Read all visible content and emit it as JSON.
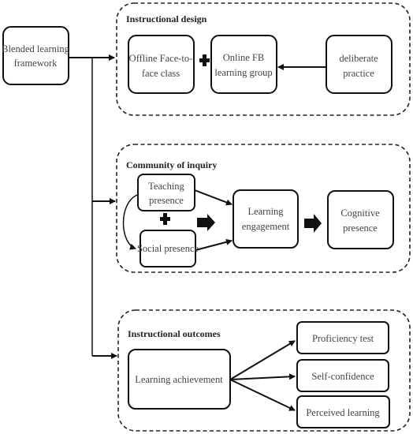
{
  "diagram": {
    "root": {
      "label_line1": "Blended learning",
      "label_line2": "framework"
    },
    "groups": {
      "instructional_design": {
        "title": "Instructional design",
        "nodes": {
          "offline": {
            "line1": "Offline Face-to-",
            "line2": "face class"
          },
          "online": {
            "line1": "Online FB",
            "line2": "learning group"
          },
          "practice": {
            "line1": "deliberate",
            "line2": "practice"
          }
        }
      },
      "community_of_inquiry": {
        "title": "Community of inquiry",
        "nodes": {
          "teaching": {
            "line1": "Teaching",
            "line2": "presence"
          },
          "social": {
            "line1": "Social presence"
          },
          "engagement": {
            "line1": "Learning",
            "line2": "engagement"
          },
          "cognitive": {
            "line1": "Cognitive",
            "line2": "presence"
          }
        }
      },
      "instructional_outcomes": {
        "title": "Instructional outcomes",
        "nodes": {
          "achievement": {
            "line1": "Learning achievement"
          },
          "proficiency": {
            "line1": "Proficiency test"
          },
          "confidence": {
            "line1": "Self-confidence"
          },
          "perceived": {
            "line1": "Perceived learning"
          }
        }
      }
    },
    "connectors": [
      {
        "from": "root",
        "to": "instructional_design",
        "type": "arrow"
      },
      {
        "from": "root",
        "to": "community_of_inquiry",
        "type": "arrow"
      },
      {
        "from": "root",
        "to": "instructional_outcomes",
        "type": "arrow"
      },
      {
        "from": "offline",
        "to": "online",
        "type": "plus"
      },
      {
        "from": "practice",
        "to": "online",
        "type": "arrow"
      },
      {
        "from": "teaching",
        "to": "social",
        "type": "plus"
      },
      {
        "from": "teaching",
        "to": "social",
        "type": "curved-arrow"
      },
      {
        "from": "teaching",
        "to": "engagement",
        "type": "arrow"
      },
      {
        "from": "social",
        "to": "engagement",
        "type": "arrow"
      },
      {
        "from": "presence",
        "to": "engagement",
        "type": "block-arrow"
      },
      {
        "from": "engagement",
        "to": "cognitive",
        "type": "block-arrow"
      },
      {
        "from": "achievement",
        "to": "proficiency",
        "type": "arrow"
      },
      {
        "from": "achievement",
        "to": "confidence",
        "type": "arrow"
      },
      {
        "from": "achievement",
        "to": "perceived",
        "type": "arrow"
      }
    ]
  }
}
